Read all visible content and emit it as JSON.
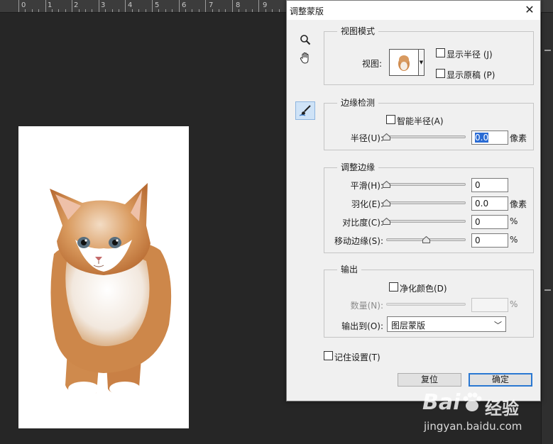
{
  "ruler": {
    "labels": [
      "0",
      "1",
      "2",
      "3",
      "4",
      "5",
      "6",
      "7",
      "8",
      "9"
    ]
  },
  "dialog": {
    "title": "调整蒙版",
    "close_glyph": "✕",
    "tools": [
      "zoom-icon",
      "hand-icon",
      "refine-radius-brush-icon"
    ],
    "view_mode": {
      "group_title": "视图模式",
      "view_label": "视图:",
      "show_radius": {
        "label": "显示半径 (J)",
        "checked": false
      },
      "show_original": {
        "label": "显示原稿 (P)",
        "checked": false
      }
    },
    "edge_detection": {
      "group_title": "边缘检测",
      "smart_radius": {
        "label": "智能半径(A)",
        "checked": false
      },
      "radius": {
        "label": "半径(U):",
        "value": "0.0",
        "unit": "像素",
        "slider_fraction": 0
      }
    },
    "adjust_edge": {
      "group_title": "调整边缘",
      "smooth": {
        "label": "平滑(H):",
        "value": "0",
        "unit": "",
        "slider_fraction": 0
      },
      "feather": {
        "label": "羽化(E):",
        "value": "0.0",
        "unit": "像素",
        "slider_fraction": 0
      },
      "contrast": {
        "label": "对比度(C):",
        "value": "0",
        "unit": "%",
        "slider_fraction": 0
      },
      "shift_edge": {
        "label": "移动边缘(S):",
        "value": "0",
        "unit": "%",
        "slider_fraction": 0.5
      }
    },
    "output": {
      "group_title": "输出",
      "decontaminate": {
        "label": "净化颜色(D)",
        "checked": false
      },
      "amount": {
        "label": "数量(N):",
        "value": "",
        "unit": "%",
        "slider_fraction": 0
      },
      "output_to_label": "输出到(O):",
      "output_to_value": "图层蒙版"
    },
    "remember": {
      "label": "记住设置(T)",
      "checked": false
    },
    "reset_label": "复位",
    "ok_label": "确定"
  },
  "watermark": {
    "brand": "Bai",
    "brand_suffix": "经验",
    "url": "jingyan.baidu.com"
  },
  "colors": {
    "workspace": "#262626",
    "dialog": "#f0f0f0",
    "selection": "#2a6bd4",
    "ok_border": "#2a78d2"
  }
}
